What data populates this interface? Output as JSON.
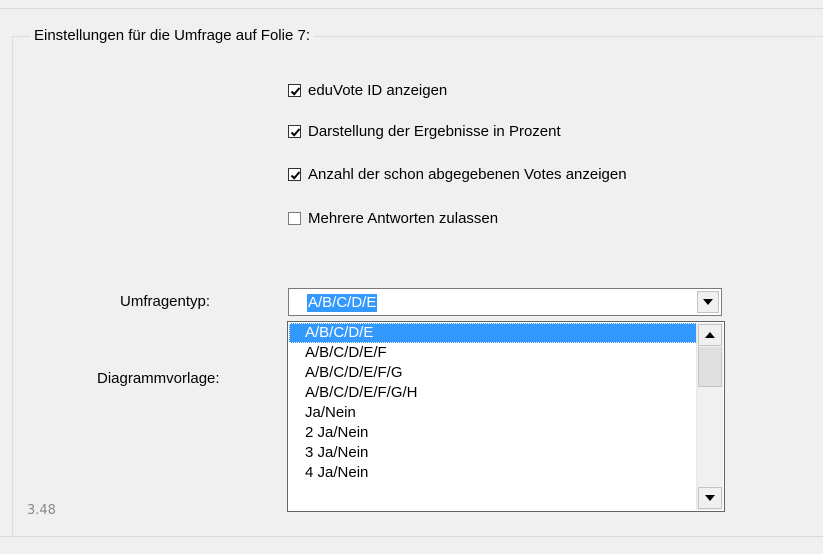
{
  "group": {
    "title": "Einstellungen für die Umfrage auf Folie 7:"
  },
  "options": [
    {
      "label": "eduVote ID anzeigen",
      "checked": true
    },
    {
      "label": "Darstellung der Ergebnisse in Prozent",
      "checked": true
    },
    {
      "label": "Anzahl der schon abgegebenen Votes anzeigen",
      "checked": true
    },
    {
      "label": "Mehrere Antworten zulassen",
      "checked": false
    }
  ],
  "fields": {
    "umfragentyp_label": "Umfragentyp:",
    "diagrammvorlage_label": "Diagrammvorlage:"
  },
  "umfragentyp": {
    "selected": "A/B/C/D/E",
    "options": [
      "A/B/C/D/E",
      "A/B/C/D/E/F",
      "A/B/C/D/E/F/G",
      "A/B/C/D/E/F/G/H",
      "Ja/Nein",
      "2 Ja/Nein",
      "3 Ja/Nein",
      "4 Ja/Nein"
    ]
  },
  "version": "3.48",
  "icons": {
    "dropdown": "chevron-down-icon",
    "scroll_up": "scroll-up-arrow-icon",
    "scroll_down": "scroll-down-arrow-icon",
    "check": "checkmark-icon"
  },
  "colors": {
    "selection": "#3399ff",
    "dialog_background": "#f0f0f0"
  }
}
